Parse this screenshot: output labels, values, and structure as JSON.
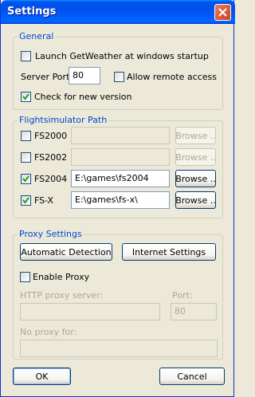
{
  "window": {
    "title": "Settings"
  },
  "general": {
    "title": "General",
    "launch_label": "Launch GetWeather at windows startup",
    "launch_checked": false,
    "server_port_label": "Server Port:",
    "server_port_value": "80",
    "allow_remote_label": "Allow remote access",
    "allow_remote_checked": false,
    "check_version_label": "Check for new version",
    "check_version_checked": true
  },
  "flightsim": {
    "title": "Flightsimulator Path",
    "rows": [
      {
        "label": "FS2000",
        "checked": false,
        "path": "",
        "browse": "Browse ..",
        "enabled": false
      },
      {
        "label": "FS2002",
        "checked": false,
        "path": "",
        "browse": "Browse ..",
        "enabled": false
      },
      {
        "label": "FS2004",
        "checked": true,
        "path": "E:\\games\\fs2004",
        "browse": "Browse ..",
        "enabled": true
      },
      {
        "label": "FS-X",
        "checked": true,
        "path": "E:\\games\\fs-x\\",
        "browse": "Browse ..",
        "enabled": true
      }
    ]
  },
  "proxy": {
    "title": "Proxy Settings",
    "auto_detect_label": "Automatic Detection",
    "internet_settings_label": "Internet Settings",
    "enable_proxy_label": "Enable Proxy",
    "enable_proxy_checked": false,
    "http_server_label": "HTTP proxy server:",
    "http_server_value": "",
    "port_label": "Port:",
    "port_value": "80",
    "no_proxy_label": "No proxy for:",
    "no_proxy_value": ""
  },
  "footer": {
    "ok_label": "OK",
    "cancel_label": "Cancel"
  }
}
